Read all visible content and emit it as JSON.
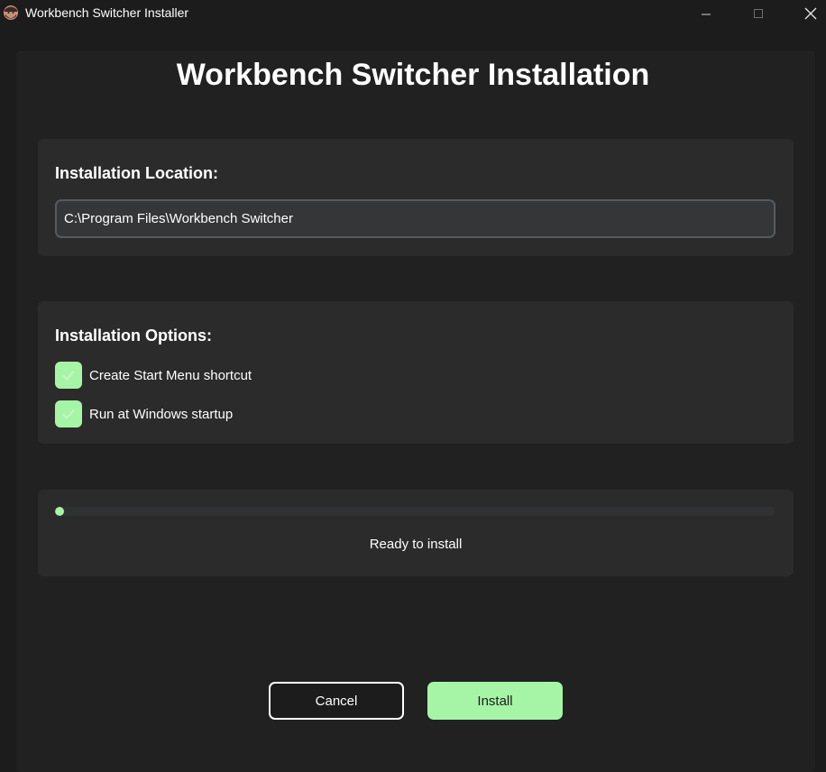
{
  "window": {
    "title": "Workbench Switcher Installer",
    "icon": "bearded-face-icon"
  },
  "page": {
    "title": "Workbench Switcher Installation"
  },
  "location": {
    "heading": "Installation Location:",
    "path_value": "C:\\Program Files\\Workbench Switcher"
  },
  "options": {
    "heading": "Installation Options:",
    "items": [
      {
        "label": "Create Start Menu shortcut",
        "checked": true
      },
      {
        "label": "Run at Windows startup",
        "checked": true
      }
    ]
  },
  "progress": {
    "value": 0,
    "status": "Ready to install"
  },
  "buttons": {
    "cancel_label": "Cancel",
    "install_label": "Install"
  },
  "colors": {
    "accent": "#a6f5a6",
    "background": "#1c1c1c",
    "panel": "#212121",
    "card": "#2b2b2b",
    "input_bg": "#343638",
    "input_border": "#565b5e"
  }
}
